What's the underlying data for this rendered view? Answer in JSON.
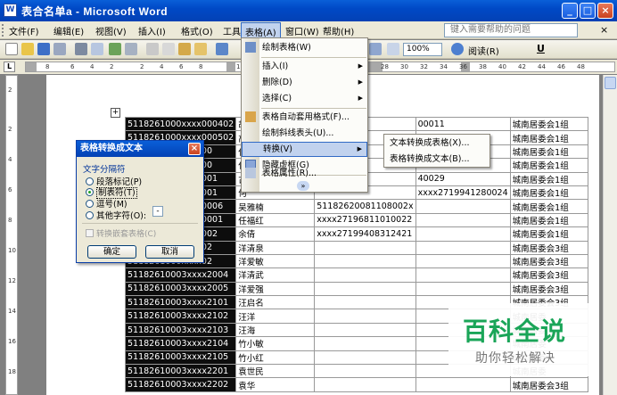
{
  "window": {
    "title": "表合名单a - Microsoft Word",
    "app_icon": "W"
  },
  "menubar": {
    "items": [
      "文件(F)",
      "编辑(E)",
      "视图(V)",
      "插入(I)",
      "格式(O)",
      "工具(T)",
      "表格(A)",
      "窗口(W)",
      "帮助(H)"
    ],
    "help_placeholder": "键入需要帮助的问题",
    "close_glyph": "×"
  },
  "toolbar": {
    "zoom": "100%",
    "read_button": "阅读(R)",
    "underline": "U"
  },
  "ruler": {
    "corner": "L",
    "ticks": [
      "8",
      "6",
      "4",
      "2",
      "2",
      "4",
      "6",
      "8",
      "12",
      "28",
      "30",
      "32",
      "34",
      "36",
      "38",
      "40",
      "42",
      "44",
      "46",
      "48"
    ],
    "vticks": [
      "2",
      "2",
      "4",
      "6",
      "8",
      "10",
      "12",
      "14",
      "16",
      "18"
    ]
  },
  "table_menu": {
    "items": [
      {
        "label": "绘制表格(W)",
        "icon": "pencil-icon"
      },
      {
        "label": "插入(I)",
        "submenu": true
      },
      {
        "label": "删除(D)",
        "submenu": true
      },
      {
        "label": "选择(C)",
        "submenu": true
      },
      {
        "label": "表格自动套用格式(F)...",
        "icon": "autoformat-icon"
      },
      {
        "label": "绘制斜线表头(U)..."
      },
      {
        "label": "转换(V)",
        "submenu": true,
        "highlighted": true
      },
      {
        "label": "隐藏虚框(G)",
        "icon": "grid-icon"
      },
      {
        "label": "表格属性(R)...",
        "icon": "table-properties-icon"
      }
    ],
    "more_glyph": "»"
  },
  "convert_submenu": {
    "items": [
      "文本转换成表格(X)...",
      "表格转换成文本(B)..."
    ]
  },
  "dialog": {
    "title": "表格转换成文本",
    "group_label": "文字分隔符",
    "options": [
      "段落标记(P)",
      "制表符(T)",
      "逗号(M)",
      "其他字符(O):"
    ],
    "selected_index": 1,
    "other_char_value": "-",
    "nested_checkbox_label": "转换嵌套表格(C)",
    "ok_label": "确定",
    "cancel_label": "取消"
  },
  "table": {
    "rows": [
      [
        "5118261000xxxx000402",
        "胡亚",
        "",
        "00011",
        "城南居委会1组"
      ],
      [
        "5118261000xxxx000502",
        "高",
        "",
        "",
        "城南居委会1组"
      ],
      [
        "5118261000xxxx00",
        "任",
        "",
        "",
        "城南居委会1组"
      ],
      [
        "5118261000xxxx00",
        "任",
        "",
        "",
        "城南居委会1组"
      ],
      [
        "5118261000xxxx001",
        "古",
        "",
        "40029",
        "城南居委会1组"
      ],
      [
        "5118261000xxxx001",
        "何",
        "",
        "xxxx2719941280024",
        "城南居委会1组"
      ],
      [
        "5118261000xxxx0006",
        "吴雅楠",
        "5118262008110800​2x",
        "",
        "城南居委会1组"
      ],
      [
        "5118261000xxxx0001",
        "任福红",
        "xxxx27196811010022",
        "",
        "城南居委会1组"
      ],
      [
        "5118261000xxxx002",
        "余倩",
        "xxxx27199408312421",
        "",
        "城南居委会1组"
      ],
      [
        "5118261000xxxx02",
        "洋清泉",
        "",
        "",
        "城南居委会3组"
      ],
      [
        "5118261000xxxx02",
        "洋爱敏",
        "",
        "",
        "城南居委会3组"
      ],
      [
        "51182610003xxxx2004",
        "洋清武",
        "",
        "",
        "城南居委会3组"
      ],
      [
        "51182610003xxxx2005",
        "洋爱强",
        "",
        "",
        "城南居委会3组"
      ],
      [
        "51182610003xxxx2101",
        "汪启名",
        "",
        "",
        "城南居委会3组"
      ],
      [
        "51182610003xxxx2102",
        "汪洋",
        "",
        "",
        "城南居委"
      ],
      [
        "51182610003xxxx2103",
        "汪海",
        "",
        "",
        "城南居委"
      ],
      [
        "51182610003xxxx2104",
        "竹小敏",
        "",
        "",
        "城南居委"
      ],
      [
        "51182610003xxxx2105",
        "竹小红",
        "",
        "",
        "城南居委"
      ],
      [
        "51182610003xxxx2201",
        "袁世民",
        "",
        "",
        "城南居委"
      ],
      [
        "51182610003xxxx2202",
        "袁华",
        "",
        "",
        "城南居委会3组"
      ]
    ]
  },
  "watermark": {
    "title": "百科全说",
    "subtitle": "助你轻松解决"
  },
  "colors": {
    "title_bar": "#0049c6",
    "menu_highlight": "#c1d2ee",
    "accent_border": "#316ac5",
    "watermark_green": "#1aa558"
  }
}
